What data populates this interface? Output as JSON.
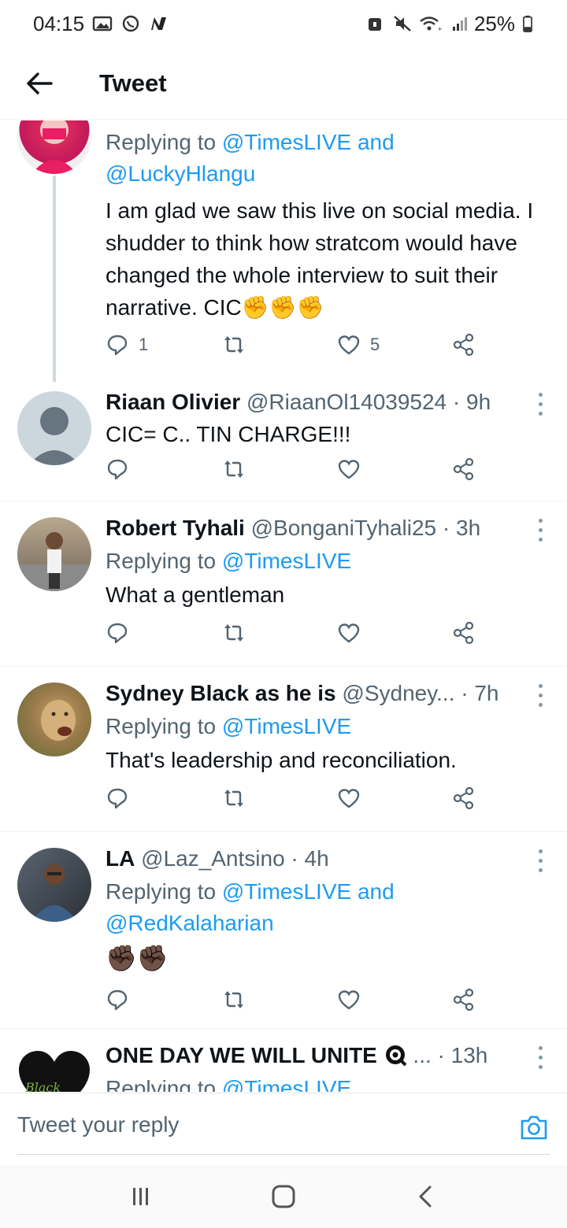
{
  "status_bar": {
    "time": "04:15",
    "battery": "25%"
  },
  "header": {
    "title": "Tweet"
  },
  "tweets": [
    {
      "reply_to_prefix": "Replying to ",
      "reply_to_1": "@TimesLIVE",
      "reply_to_and": " and",
      "reply_to_2": "@LuckyHlangu",
      "text": "I am glad we saw this live on social media. I shudder to think how stratcom would have changed the whole interview to suit their narrative. CIC✊✊✊",
      "replies": "1",
      "likes": "5"
    },
    {
      "name": "Riaan Olivier",
      "handle": "@RiaanOl14039524",
      "sep": " · ",
      "time": "9h",
      "text": "CIC= C.. TIN CHARGE!!!"
    },
    {
      "name": "Robert Tyhali",
      "handle": "@BonganiTyhali25",
      "sep": " · ",
      "time": "3h",
      "reply_to_prefix": "Replying to ",
      "reply_to_1": "@TimesLIVE",
      "text": "What a gentleman"
    },
    {
      "name": "Sydney Black as he is",
      "handle": "@Sydney...",
      "sep": " · ",
      "time": "7h",
      "reply_to_prefix": "Replying to ",
      "reply_to_1": "@TimesLIVE",
      "text": "That's leadership and reconciliation."
    },
    {
      "name": "LA",
      "handle": "@Laz_Antsino",
      "sep": " · ",
      "time": "4h",
      "reply_to_prefix": "Replying to ",
      "reply_to_1": "@TimesLIVE",
      "reply_to_and": " and",
      "reply_to_2": "@RedKalaharian",
      "text": "✊🏿✊🏿"
    },
    {
      "name": "ONE DAY WE WILL UNITE",
      "handle": "...",
      "sep": " · ",
      "time": "13h",
      "reply_to_prefix": "Replying to ",
      "reply_to_1": "@TimesLIVE",
      "avatar_text": "Black"
    }
  ],
  "reply_bar": {
    "placeholder": "Tweet your reply"
  },
  "icons": {
    "accent": "#1d9bf0",
    "muted": "#536471"
  }
}
